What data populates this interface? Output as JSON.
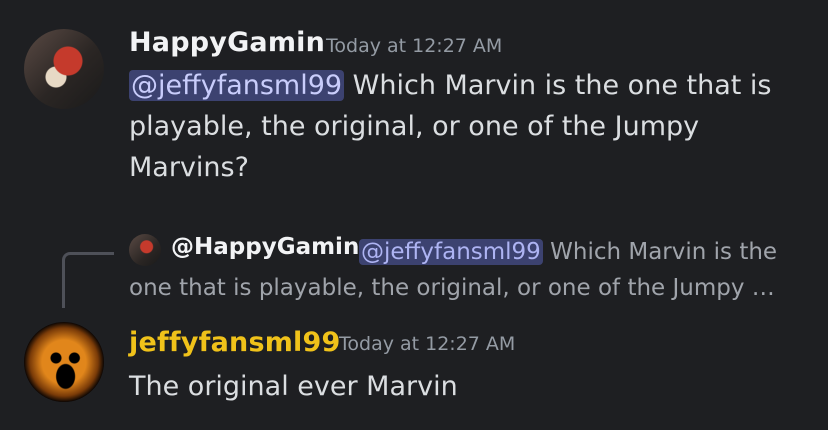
{
  "messages": [
    {
      "username": "HappyGamin",
      "username_color": "#f2f3f5",
      "timestamp": "Today at 12:27 AM",
      "mention": "@jeffyfansml99",
      "text": " Which Marvin is the one that is playable, the original, or one of the Jumpy Marvins?"
    },
    {
      "reply": {
        "username": "@HappyGamin",
        "mention": "@jeffyfansml99",
        "text": " Which Marvin is the one that is playable, the original, or one of the Jumpy …"
      },
      "username": "jeffyfansml99",
      "username_color": "#f0c21a",
      "timestamp": "Today at 12:27 AM",
      "text": "The original ever Marvin"
    }
  ]
}
